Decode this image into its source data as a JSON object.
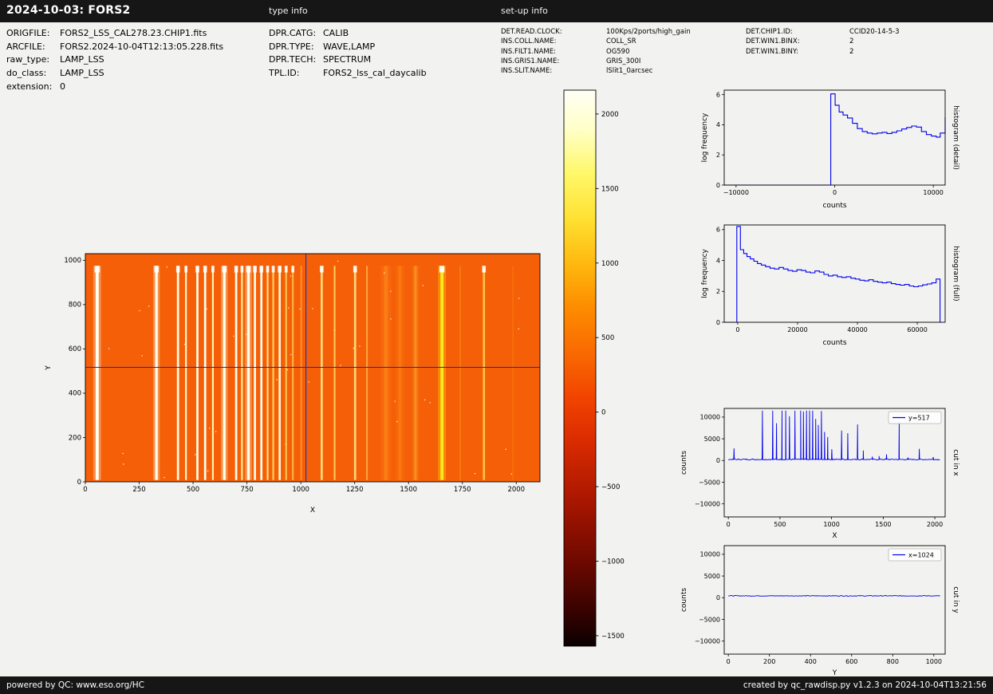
{
  "header": {
    "title": "2024-10-03: FORS2",
    "type_info_label": "type info",
    "setup_info_label": "set-up info"
  },
  "file_info": [
    {
      "label": "ORIGFILE:",
      "value": "FORS2_LSS_CAL278.23.CHIP1.fits"
    },
    {
      "label": "ARCFILE:",
      "value": "FORS2.2024-10-04T12:13:05.228.fits"
    },
    {
      "label": "raw_type:",
      "value": "LAMP_LSS"
    },
    {
      "label": "do_class:",
      "value": "LAMP_LSS"
    },
    {
      "label": "extension:",
      "value": "0"
    }
  ],
  "type_info": [
    {
      "label": "DPR.CATG:",
      "value": "CALIB"
    },
    {
      "label": "DPR.TYPE:",
      "value": "WAVE,LAMP"
    },
    {
      "label": "DPR.TECH:",
      "value": "SPECTRUM"
    },
    {
      "label": "TPL.ID:",
      "value": "FORS2_lss_cal_daycalib"
    }
  ],
  "setup_info_left": [
    {
      "label": "DET.READ.CLOCK:",
      "value": "100Kps/2ports/high_gain"
    },
    {
      "label": "INS.COLL.NAME:",
      "value": "COLL_SR"
    },
    {
      "label": "INS.FILT1.NAME:",
      "value": "OG590"
    },
    {
      "label": "INS.GRIS1.NAME:",
      "value": "GRIS_300I"
    },
    {
      "label": "INS.SLIT.NAME:",
      "value": "lSlit1_0arcsec"
    }
  ],
  "setup_info_right": [
    {
      "label": "DET.CHIP1.ID:",
      "value": "CCID20-14-5-3"
    },
    {
      "label": "DET.WIN1.BINX:",
      "value": "2"
    },
    {
      "label": "DET.WIN1.BINY:",
      "value": "2"
    }
  ],
  "footer": {
    "left": "powered by QC: www.eso.org/HC",
    "right": "created by qc_rawdisp.py v1.2.3 on 2024-10-04T13:21:56"
  },
  "colors": {
    "bar_background": "#161616",
    "bar_text": "#ffffff",
    "page_background": "#f2f2f0",
    "plot_line": "#0000ee",
    "crosshair": "#0033cc",
    "axis": "#000000",
    "legend_border": "#b5b5b5"
  },
  "chart_data": [
    {
      "id": "raw_image",
      "type": "heatmap",
      "xlabel": "X",
      "ylabel": "Y",
      "xlim": [
        0,
        2110
      ],
      "ylim": [
        0,
        1030
      ],
      "xticks": [
        0,
        250,
        500,
        750,
        1000,
        1250,
        1500,
        1750,
        2000
      ],
      "yticks": [
        0,
        200,
        400,
        600,
        800,
        1000
      ],
      "background_color": "#f55f08",
      "crosshair": {
        "x": 1024,
        "y": 517
      },
      "line_y_extent": [
        8,
        975
      ],
      "emission_lines": [
        {
          "x": 55,
          "w": 7,
          "color": "#fffff2",
          "cap": true
        },
        {
          "x": 330,
          "w": 6,
          "color": "#ffffe9",
          "cap": true
        },
        {
          "x": 430,
          "w": 5,
          "color": "#ffffe9",
          "cap": true
        },
        {
          "x": 467,
          "w": 4,
          "color": "#fff6cc",
          "cap": true
        },
        {
          "x": 520,
          "w": 5,
          "color": "#ffffe9",
          "cap": true
        },
        {
          "x": 556,
          "w": 5,
          "color": "#ffffee",
          "cap": true
        },
        {
          "x": 592,
          "w": 4,
          "color": "#fff3b0",
          "cap": true
        },
        {
          "x": 645,
          "w": 6,
          "color": "#ffffe9",
          "cap": true
        },
        {
          "x": 700,
          "w": 5,
          "color": "#ffffe9",
          "cap": true
        },
        {
          "x": 727,
          "w": 4,
          "color": "#ffeda0",
          "cap": true
        },
        {
          "x": 757,
          "w": 6,
          "color": "#ffffe9",
          "cap": true
        },
        {
          "x": 787,
          "w": 5,
          "color": "#ffffe9",
          "cap": true
        },
        {
          "x": 817,
          "w": 5,
          "color": "#ffffe9",
          "cap": true
        },
        {
          "x": 846,
          "w": 4,
          "color": "#ffdf80",
          "cap": true
        },
        {
          "x": 872,
          "w": 4,
          "color": "#ffd162",
          "cap": true
        },
        {
          "x": 902,
          "w": 5,
          "color": "#fff8cc",
          "cap": true
        },
        {
          "x": 932,
          "w": 4,
          "color": "#ffc250",
          "cap": true
        },
        {
          "x": 963,
          "w": 4,
          "color": "#ffb240",
          "cap": true
        },
        {
          "x": 1002,
          "w": 3,
          "color": "#ff9a30",
          "cap": false
        },
        {
          "x": 1097,
          "w": 5,
          "color": "#ffd876",
          "cap": true
        },
        {
          "x": 1157,
          "w": 4,
          "color": "#ffc756",
          "cap": false
        },
        {
          "x": 1252,
          "w": 5,
          "color": "#ffd876",
          "cap": true
        },
        {
          "x": 1307,
          "w": 4,
          "color": "#ffa036",
          "cap": false
        },
        {
          "x": 1395,
          "w": 9,
          "color": "#fb7d15",
          "cap": false
        },
        {
          "x": 1460,
          "w": 8,
          "color": "#fa7710",
          "cap": false
        },
        {
          "x": 1532,
          "w": 6,
          "color": "#fc8c20",
          "cap": false
        },
        {
          "x": 1655,
          "w": 7,
          "color": "#ffe818",
          "cap": true
        },
        {
          "x": 1740,
          "w": 3,
          "color": "#f87c12",
          "cap": false
        },
        {
          "x": 1850,
          "w": 5,
          "color": "#ffc245",
          "cap": true
        },
        {
          "x": 1985,
          "w": 3,
          "color": "#f7720a",
          "cap": false
        }
      ]
    },
    {
      "id": "colorbar",
      "type": "colorbar",
      "vmin": -1570,
      "vmax": 2160,
      "ticks": [
        2000,
        1500,
        1000,
        500,
        0,
        -500,
        -1000,
        -1500
      ],
      "stops": [
        {
          "value": 2160,
          "color": "#fffff6"
        },
        {
          "value": 1900,
          "color": "#ffffc8"
        },
        {
          "value": 1600,
          "color": "#fff869"
        },
        {
          "value": 1300,
          "color": "#ffe133"
        },
        {
          "value": 1000,
          "color": "#ffb90f"
        },
        {
          "value": 700,
          "color": "#fd8c00"
        },
        {
          "value": 400,
          "color": "#f96a02"
        },
        {
          "value": 100,
          "color": "#f24400"
        },
        {
          "value": -200,
          "color": "#d92b00"
        },
        {
          "value": -600,
          "color": "#a81600"
        },
        {
          "value": -1000,
          "color": "#6e0900"
        },
        {
          "value": -1300,
          "color": "#3d0300"
        },
        {
          "value": -1570,
          "color": "#0b0000"
        }
      ]
    },
    {
      "id": "histogram_detail",
      "type": "line",
      "right_label": "histogram (detail)",
      "xlabel": "counts",
      "ylabel": "log frequency",
      "xlim": [
        -11200,
        11200
      ],
      "ylim": [
        0,
        6.3
      ],
      "xticks": [
        -10000,
        0,
        10000
      ],
      "yticks": [
        0,
        2,
        4,
        6
      ],
      "step_points": [
        [
          -400,
          6.05
        ],
        [
          50,
          5.3
        ],
        [
          450,
          4.85
        ],
        [
          850,
          4.65
        ],
        [
          1300,
          4.45
        ],
        [
          1800,
          4.1
        ],
        [
          2300,
          3.75
        ],
        [
          2800,
          3.55
        ],
        [
          3300,
          3.45
        ],
        [
          3800,
          3.4
        ],
        [
          4300,
          3.45
        ],
        [
          4800,
          3.5
        ],
        [
          5300,
          3.42
        ],
        [
          5800,
          3.5
        ],
        [
          6300,
          3.6
        ],
        [
          6800,
          3.72
        ],
        [
          7300,
          3.82
        ],
        [
          7800,
          3.92
        ],
        [
          8300,
          3.85
        ],
        [
          8800,
          3.55
        ],
        [
          9300,
          3.35
        ],
        [
          9800,
          3.25
        ],
        [
          10300,
          3.18
        ],
        [
          10700,
          3.45
        ],
        [
          11200,
          4.5
        ]
      ]
    },
    {
      "id": "histogram_full",
      "type": "line",
      "right_label": "histogram (full)",
      "xlabel": "counts",
      "ylabel": "log frequency",
      "xlim": [
        -4500,
        69300
      ],
      "ylim": [
        0,
        6.3
      ],
      "xticks": [
        0,
        20000,
        40000,
        60000
      ],
      "yticks": [
        0,
        2,
        4,
        6
      ],
      "step_points": [
        [
          -300,
          6.2
        ],
        [
          900,
          4.7
        ],
        [
          2000,
          4.45
        ],
        [
          3100,
          4.25
        ],
        [
          4200,
          4.1
        ],
        [
          5400,
          3.95
        ],
        [
          6600,
          3.8
        ],
        [
          7900,
          3.7
        ],
        [
          9300,
          3.6
        ],
        [
          10800,
          3.5
        ],
        [
          12300,
          3.45
        ],
        [
          13800,
          3.55
        ],
        [
          15300,
          3.45
        ],
        [
          16800,
          3.35
        ],
        [
          18300,
          3.3
        ],
        [
          19800,
          3.4
        ],
        [
          21300,
          3.35
        ],
        [
          22800,
          3.25
        ],
        [
          24300,
          3.2
        ],
        [
          25800,
          3.32
        ],
        [
          27300,
          3.25
        ],
        [
          28800,
          3.1
        ],
        [
          30300,
          3.0
        ],
        [
          31800,
          3.05
        ],
        [
          33300,
          2.95
        ],
        [
          34800,
          2.9
        ],
        [
          36300,
          2.95
        ],
        [
          37800,
          2.85
        ],
        [
          39300,
          2.8
        ],
        [
          40800,
          2.72
        ],
        [
          42300,
          2.68
        ],
        [
          43800,
          2.75
        ],
        [
          45300,
          2.65
        ],
        [
          46800,
          2.6
        ],
        [
          48300,
          2.55
        ],
        [
          49800,
          2.6
        ],
        [
          51300,
          2.5
        ],
        [
          52800,
          2.45
        ],
        [
          54300,
          2.4
        ],
        [
          55800,
          2.45
        ],
        [
          57300,
          2.35
        ],
        [
          58800,
          2.3
        ],
        [
          60300,
          2.35
        ],
        [
          61800,
          2.42
        ],
        [
          63300,
          2.48
        ],
        [
          64800,
          2.55
        ],
        [
          66300,
          2.8
        ],
        [
          67600,
          0
        ]
      ]
    },
    {
      "id": "cut_in_x",
      "type": "line",
      "legend": "y=517",
      "right_label": "cut in x",
      "xlabel": "X",
      "ylabel": "counts",
      "xlim": [
        -40,
        2100
      ],
      "ylim": [
        -13000,
        12000
      ],
      "xticks": [
        0,
        500,
        1000,
        1500,
        2000
      ],
      "yticks": [
        -10000,
        -5000,
        0,
        5000,
        10000
      ],
      "x_range": [
        0,
        2048
      ],
      "baseline": 250,
      "noise": 260,
      "spikes": [
        [
          55,
          2800
        ],
        [
          330,
          11500
        ],
        [
          430,
          11500
        ],
        [
          467,
          8600
        ],
        [
          520,
          11500
        ],
        [
          556,
          11500
        ],
        [
          592,
          10200
        ],
        [
          645,
          11500
        ],
        [
          700,
          11500
        ],
        [
          727,
          11300
        ],
        [
          757,
          11500
        ],
        [
          787,
          11500
        ],
        [
          817,
          11500
        ],
        [
          846,
          9600
        ],
        [
          872,
          8200
        ],
        [
          902,
          11400
        ],
        [
          932,
          6600
        ],
        [
          963,
          5400
        ],
        [
          1002,
          2600
        ],
        [
          1097,
          6900
        ],
        [
          1157,
          6300
        ],
        [
          1252,
          8300
        ],
        [
          1307,
          2300
        ],
        [
          1395,
          900
        ],
        [
          1460,
          1000
        ],
        [
          1532,
          1400
        ],
        [
          1655,
          9300
        ],
        [
          1740,
          700
        ],
        [
          1850,
          2700
        ],
        [
          1985,
          800
        ]
      ]
    },
    {
      "id": "cut_in_y",
      "type": "line",
      "legend": "x=1024",
      "right_label": "cut in y",
      "xlabel": "Y",
      "ylabel": "counts",
      "xlim": [
        -20,
        1055
      ],
      "ylim": [
        -13000,
        12000
      ],
      "xticks": [
        0,
        200,
        400,
        600,
        800,
        1000
      ],
      "yticks": [
        -10000,
        -5000,
        0,
        5000,
        10000
      ],
      "x_range": [
        0,
        1030
      ],
      "baseline": 430,
      "noise": 160,
      "spikes": []
    }
  ]
}
